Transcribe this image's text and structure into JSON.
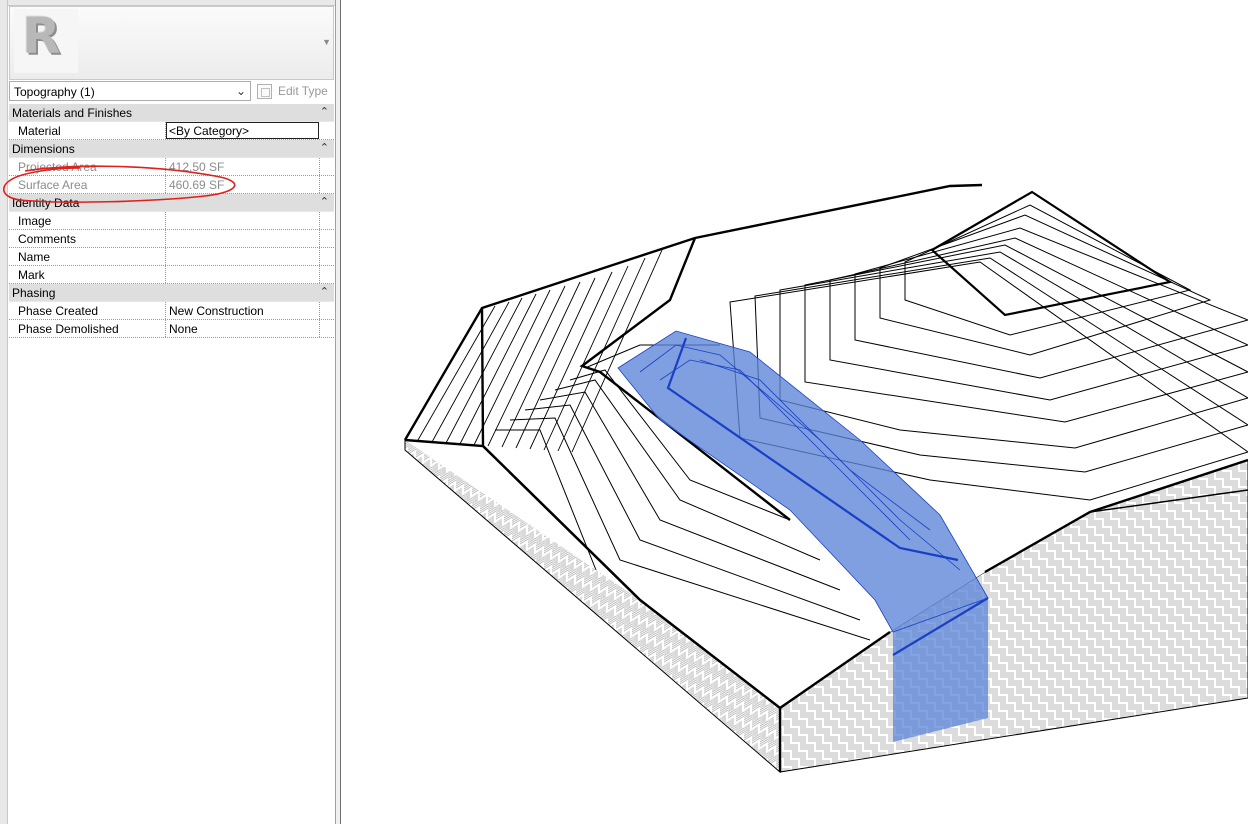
{
  "properties_panel": {
    "instance_selector": "Topography (1)",
    "edit_type_label": "Edit Type",
    "groups": [
      {
        "title": "Materials and Finishes",
        "rows": [
          {
            "label": "Material",
            "value": "<By Category>"
          }
        ]
      },
      {
        "title": "Dimensions",
        "rows": [
          {
            "label": "Projected Area",
            "value": "412.50 SF"
          },
          {
            "label": "Surface Area",
            "value": "460.69 SF"
          }
        ]
      },
      {
        "title": "Identity Data",
        "rows": [
          {
            "label": "Image",
            "value": ""
          },
          {
            "label": "Comments",
            "value": ""
          },
          {
            "label": "Name",
            "value": ""
          },
          {
            "label": "Mark",
            "value": ""
          }
        ]
      },
      {
        "title": "Phasing",
        "rows": [
          {
            "label": "Phase Created",
            "value": "New Construction"
          },
          {
            "label": "Phase Demolished",
            "value": "None"
          }
        ]
      }
    ]
  },
  "icons": {
    "logo": "revit-logo-icon",
    "collapse": "collapse-chevron-icon",
    "dropdown": "chevron-down-icon",
    "edit_type": "edit-type-icon"
  },
  "colors": {
    "selection_fill": "#5b84d8",
    "selection_edge": "#1a3fc4",
    "annotation": "#e0201c",
    "group_header": "#dedede"
  }
}
